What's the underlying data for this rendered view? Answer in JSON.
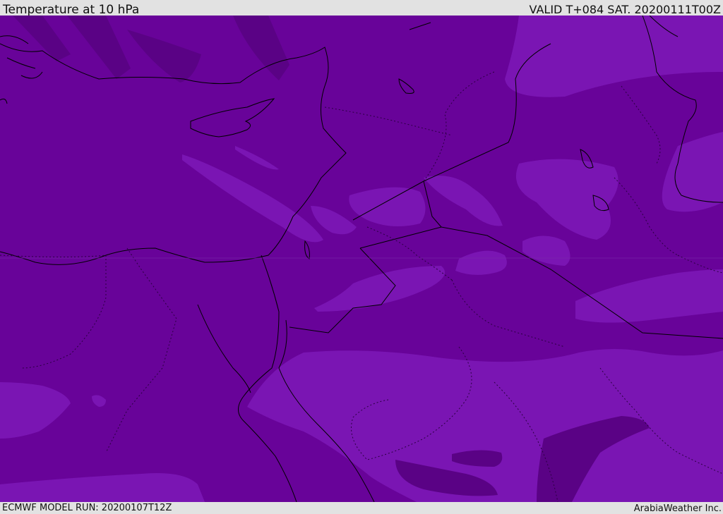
{
  "header": {
    "title": "Temperature at 10 hPa",
    "valid": "VALID T+084 SAT. 20200111T00Z"
  },
  "footer": {
    "model_run": "ECMWF MODEL RUN: 20200107T12Z",
    "credit": "ArabiaWeather Inc."
  },
  "colors": {
    "base_fill": "#680399",
    "light_band": "#7a15b3",
    "dark_band": "#5a0285",
    "coastline": "#000000",
    "border_dotted": "#2a0040"
  }
}
